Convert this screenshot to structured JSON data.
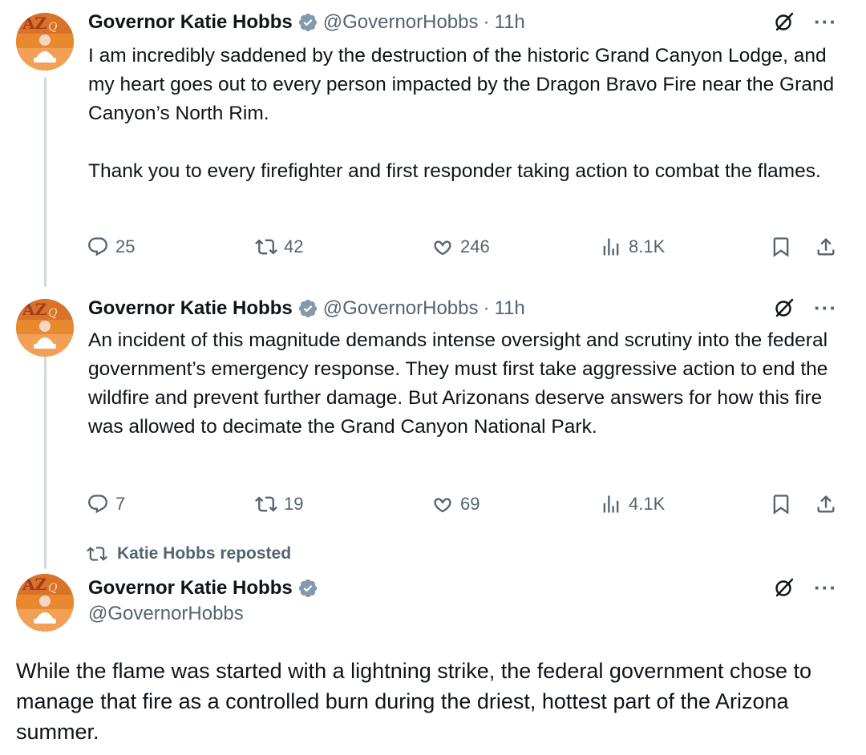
{
  "tweets": [
    {
      "author_name": "Governor Katie Hobbs",
      "handle": "@GovernorHobbs",
      "separator": "·",
      "time": "11h",
      "paragraphs": [
        "I am incredibly saddened by the destruction of the historic Grand Canyon Lodge, and my heart goes out to every person impacted by the Dragon Bravo Fire near the Grand Canyon’s North Rim.",
        "Thank you to every firefighter and first responder taking action to combat the flames."
      ],
      "replies": "25",
      "reposts": "42",
      "likes": "246",
      "views": "8.1K"
    },
    {
      "author_name": "Governor Katie Hobbs",
      "handle": "@GovernorHobbs",
      "separator": "·",
      "time": "11h",
      "paragraphs": [
        "An incident of this magnitude demands intense oversight and scrutiny into the federal government’s emergency response. They must first take aggressive action to end the wildfire and prevent further damage. But Arizonans deserve answers for how this fire was allowed to decimate the Grand Canyon National Park."
      ],
      "replies": "7",
      "reposts": "19",
      "likes": "69",
      "views": "4.1K"
    }
  ],
  "repost": {
    "label": "Katie Hobbs reposted",
    "author_name": "Governor Katie Hobbs",
    "handle": "@GovernorHobbs",
    "text": "While the flame was started with a lightning strike, the federal government chose to manage that fire as a controlled burn during the driest, hottest part of the Arizona summer."
  },
  "colors": {
    "text": "#0f1419",
    "secondary": "#536471",
    "verified_badge": "#829aab",
    "thread_line": "#cfd9de",
    "avatar_bg": "#e9892f"
  },
  "icons": {
    "verified": "verified-badge-icon",
    "grok": "grok-icon",
    "more": "more-icon",
    "reply": "reply-icon",
    "retweet": "retweet-icon",
    "like": "heart-icon",
    "views": "views-icon",
    "bookmark": "bookmark-icon",
    "share": "share-icon"
  }
}
